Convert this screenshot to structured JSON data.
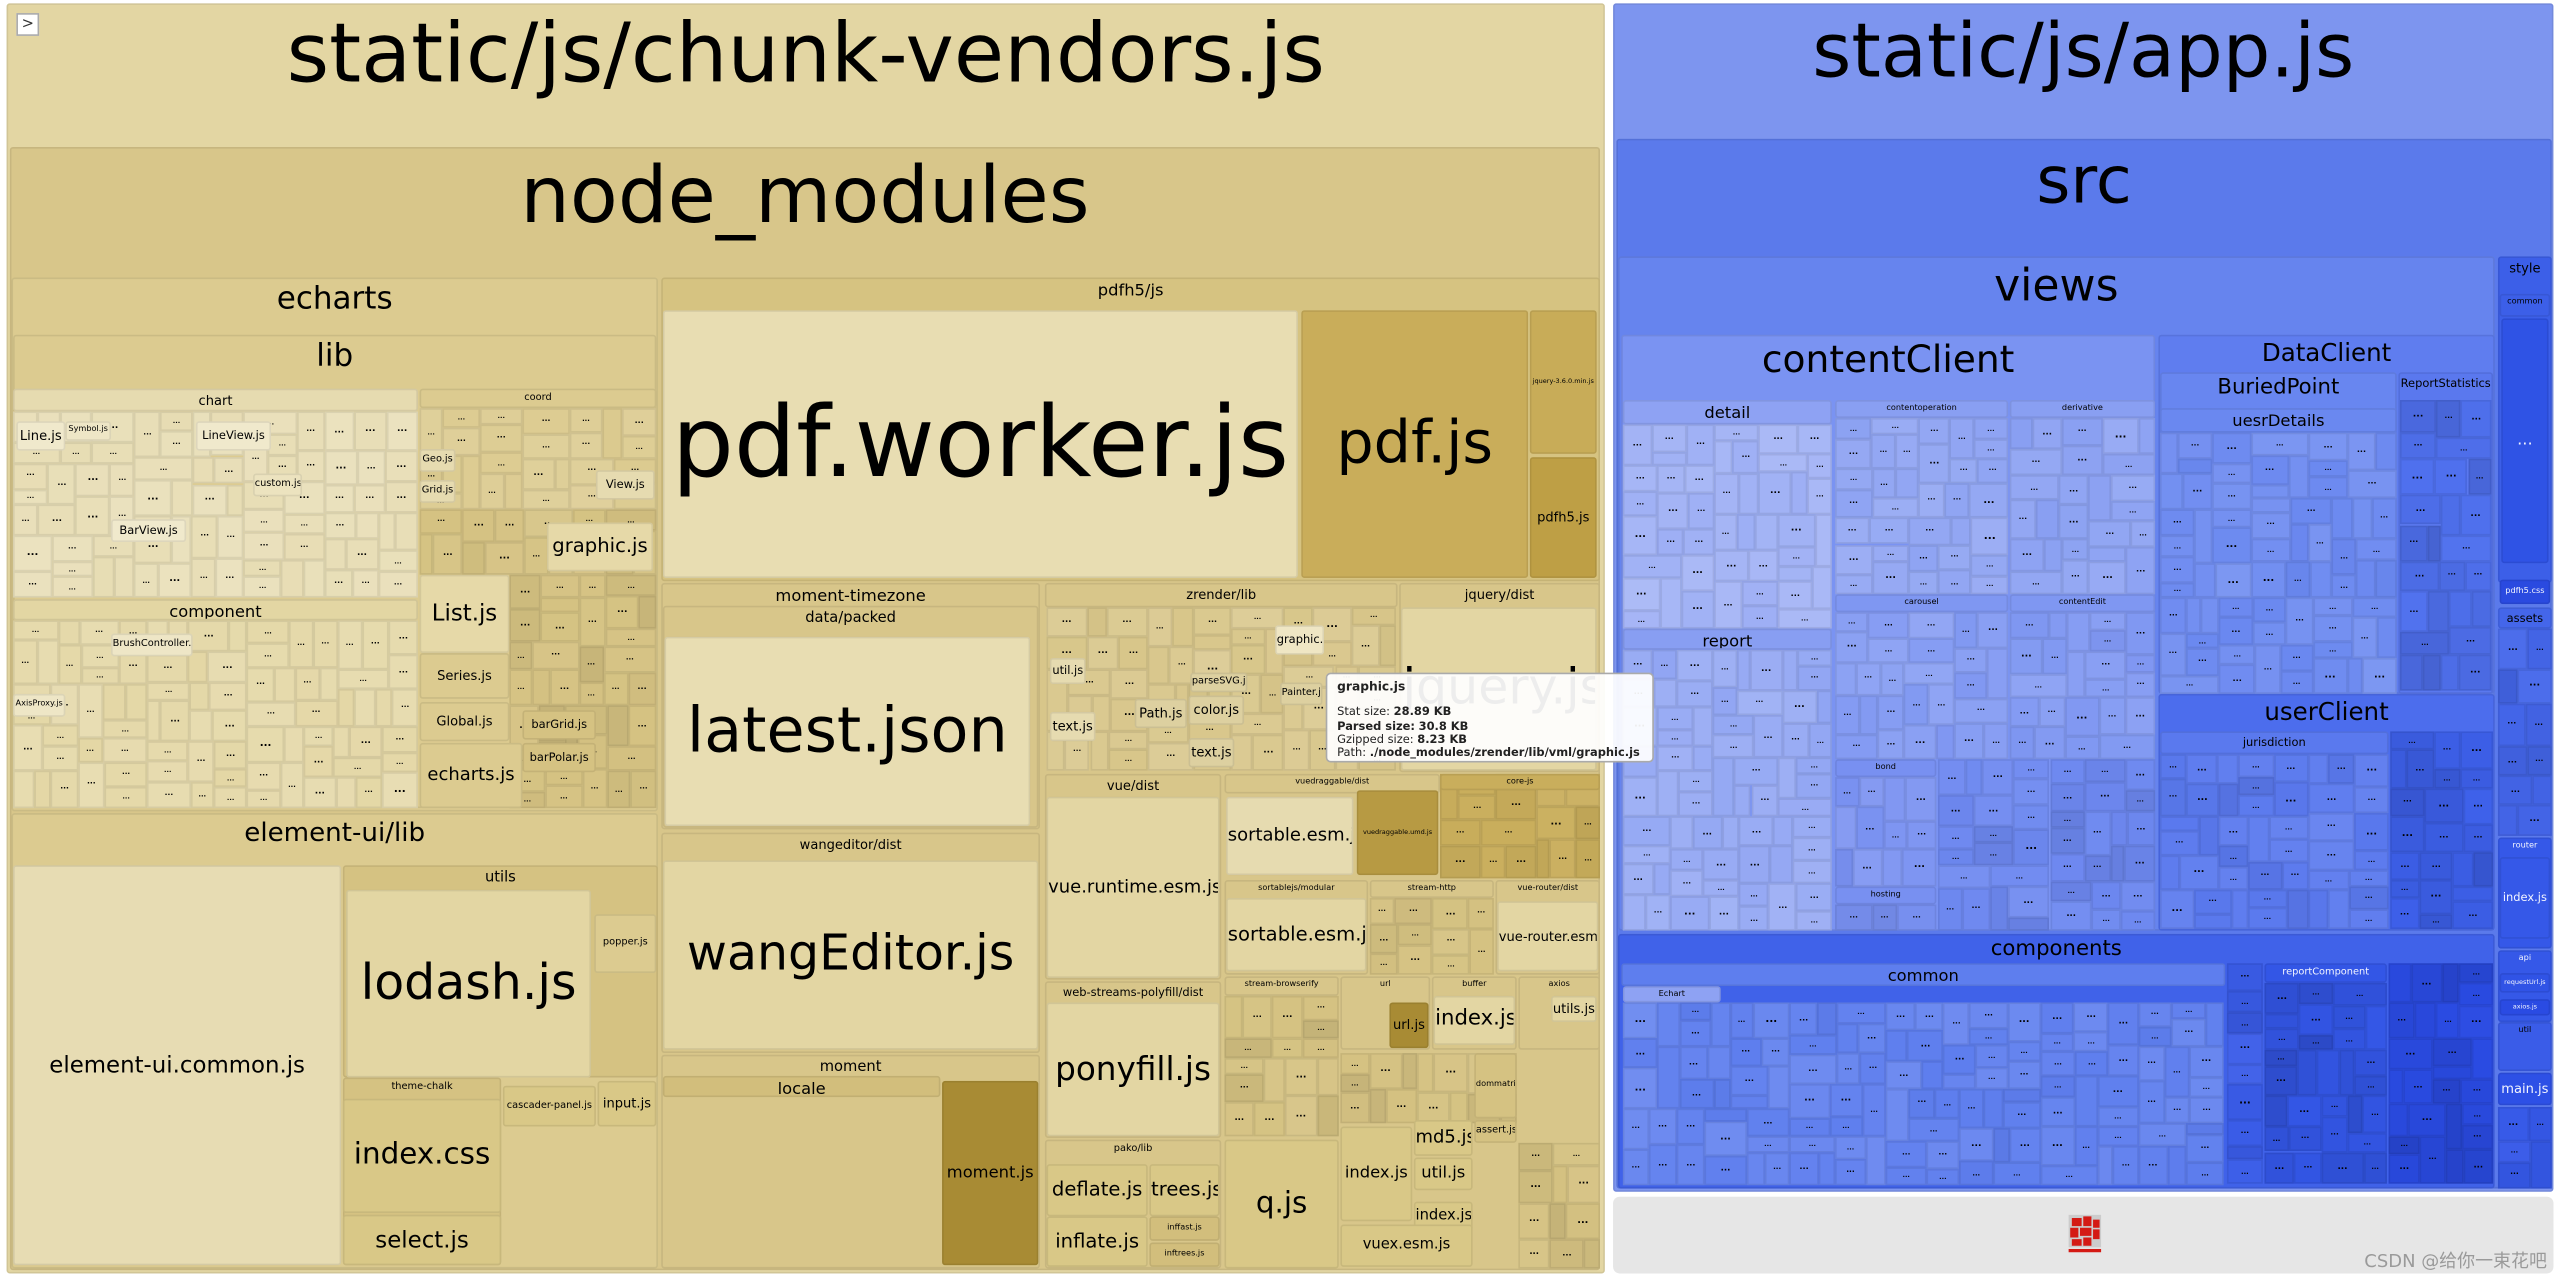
{
  "toggle_sidebar": ">",
  "ellipsis": "...",
  "colors": {
    "vendors_base": "#e3d6a3",
    "app_base": "#7d95ef"
  },
  "v": {
    "title": "static/js/chunk-vendors.js",
    "node_modules": "node_modules",
    "echarts": "echarts",
    "lib": "lib",
    "chart": "chart",
    "coord": "coord",
    "component": "component",
    "line": "Line.js",
    "symbol": "Symbol.js",
    "lineview": "LineView.js",
    "barview": "BarView.js",
    "custom": "custom.js",
    "list": "List.js",
    "graphic": "graphic.js",
    "geo": "Geo.js",
    "grid": "Grid.js",
    "view": "View.js",
    "series": "Series.js",
    "global": "Global.js",
    "bargrid": "barGrid.js",
    "barpolar": "barPolar.js",
    "echartsjs": "echarts.js",
    "axisproxy": "AxisProxy.js",
    "brushcontroller": "BrushController.js",
    "element_ui": "element-ui/lib",
    "element_ui_common": "element-ui.common.js",
    "utils": "utils",
    "lodash": "lodash.js",
    "popper": "popper.js",
    "theme_chalk": "theme-chalk",
    "index_css": "index.css",
    "select_js": "select.js",
    "cascader_panel": "cascader-panel.js",
    "input_js": "input.js",
    "pdfh5": "pdfh5/js",
    "pdf_worker": "pdf.worker.js",
    "pdf_js": "pdf.js",
    "jquery_min": "jquery-3.6.0.min.js",
    "pdfh5_js": "pdfh5.js",
    "moment_timezone": "moment-timezone",
    "data_packed": "data/packed",
    "latest_json": "latest.json",
    "wangeditor": "wangeditor/dist",
    "wangeditor_js": "wangEditor.js",
    "moment": "moment",
    "locale": "locale",
    "moment_js": "moment.js",
    "zrender": "zrender/lib",
    "text_js": "text.js",
    "util_js": "util.js",
    "path_js": "Path.js",
    "color_js": "color.js",
    "painter_js": "Painter.js",
    "graphic_js": "graphic.js",
    "parsesvg": "parseSVG.js",
    "jquery_dist": "jquery/dist",
    "jquery_js": "jquery.js",
    "vue_dist": "vue/dist",
    "vue_runtime": "vue.runtime.esm.js",
    "web_streams": "web-streams-polyfill/dist",
    "ponyfill": "ponyfill.js",
    "pako": "pako/lib",
    "deflate": "deflate.js",
    "trees": "trees.js",
    "inflate": "inflate.js",
    "inffast": "inffast.js",
    "inftrees": "inftrees.js",
    "vuedraggable": "vuedraggable/dist",
    "sortable1": "sortable.esm.js",
    "vuedraggable_umd": "vuedraggable.umd.js",
    "sortablejs": "sortablejs/modular",
    "sortable2": "sortable.esm.js",
    "stream_http": "stream-http",
    "vue_router": "vue-router/dist",
    "vue_router_esm": "vue-router.esm.js",
    "stream_browserify": "stream-browserify",
    "url": "url",
    "url_js": "url.js",
    "buffer": "buffer",
    "buffer_index": "index.js",
    "axios": "axios",
    "axios_utils": "utils.js",
    "q_js": "q.js",
    "index_js": "index.js",
    "md5": "md5.js",
    "util_js2": "util.js",
    "index_js2": "index.js",
    "vuex": "vuex.esm.js",
    "dommatrix": "dommatrix.js",
    "assert_js": "assert.js",
    "core_js": "core-js"
  },
  "a": {
    "title": "static/js/app.js",
    "src": "src",
    "views": "views",
    "contentClient": "contentClient",
    "detail": "detail",
    "report": "report",
    "contentoperation": "contentoperation",
    "derivative": "derivative",
    "carousel": "carousel",
    "contentEdit": "contentEdit",
    "bond": "bond",
    "hosting": "hosting",
    "DataClient": "DataClient",
    "BuriedPoint": "BuriedPoint",
    "ReportStatistics": "ReportStatistics",
    "uesrDetails": "uesrDetails",
    "userClient": "userClient",
    "jurisdiction": "jurisdiction",
    "components": "components",
    "common": "common",
    "echart": "Echart",
    "reportComponent": "reportComponent",
    "style": "style",
    "style_common": "common",
    "style_main": "...",
    "pdfh5_css": "pdfh5.css",
    "assets": "assets",
    "router": "router",
    "router_index": "index.js",
    "api": "api",
    "request": "requestUrl.js",
    "axios_js": "axios.js",
    "util": "util",
    "main_js": "main.js"
  },
  "tooltip": {
    "title": "graphic.js",
    "stat_label": "Stat size:",
    "stat_value": "28.89 KB",
    "parsed_label": "Parsed size:",
    "parsed_value": "30.8 KB",
    "gzip_label": "Gzipped size:",
    "gzip_value": "8.23 KB",
    "path_label": "Path:",
    "path_value": "./node_modules/zrender/lib/vml/graphic.js"
  },
  "watermark": "CSDN @给你一束花吧"
}
